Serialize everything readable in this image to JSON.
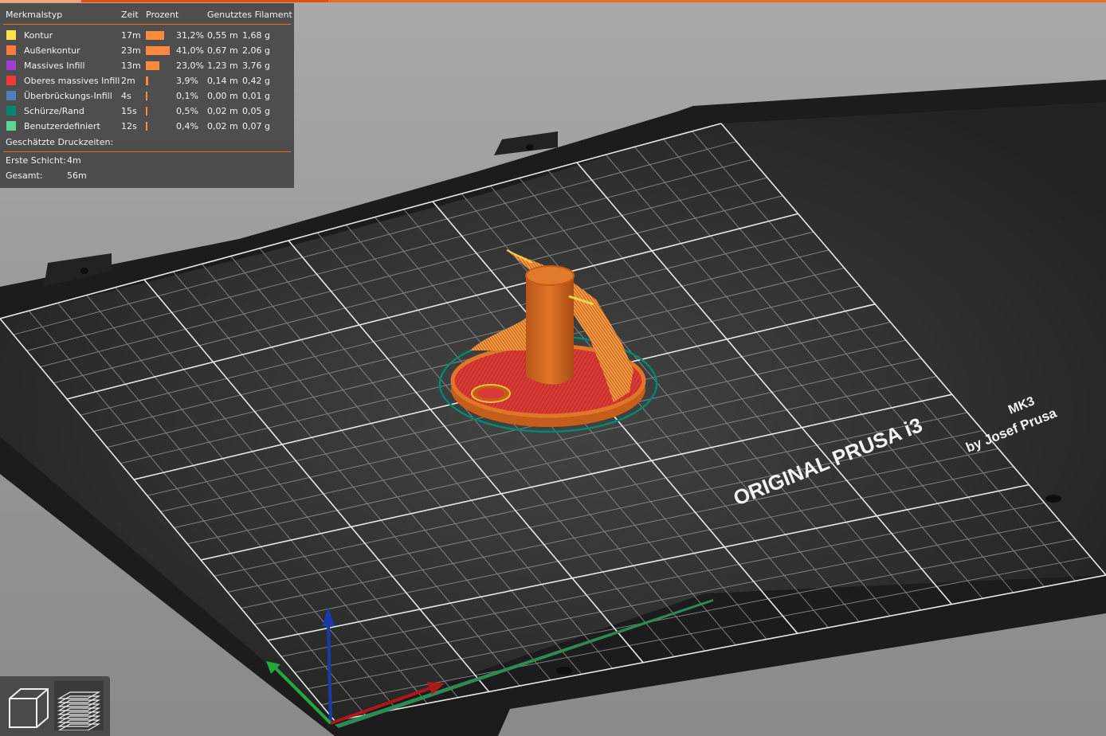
{
  "legend": {
    "headers": {
      "type": "Merkmalstyp",
      "time": "Zeit",
      "percent": "Prozent",
      "filament": "Genutztes Filament"
    },
    "rows": [
      {
        "name": "Kontur",
        "color": "#ffe34a",
        "time": "17m",
        "percent": "31,2%",
        "pct": 31.2,
        "length": "0,55 m",
        "weight": "1,68 g"
      },
      {
        "name": "Außenkontur",
        "color": "#ff7d38",
        "time": "23m",
        "percent": "41,0%",
        "pct": 41.0,
        "length": "0,67 m",
        "weight": "2,06 g"
      },
      {
        "name": "Massives Infill",
        "color": "#9b3fd6",
        "time": "13m",
        "percent": "23,0%",
        "pct": 23.0,
        "length": "1,23 m",
        "weight": "3,76 g"
      },
      {
        "name": "Oberes massives Infill",
        "color": "#f03a3a",
        "time": "2m",
        "percent": "3,9%",
        "pct": 3.9,
        "length": "0,14 m",
        "weight": "0,42 g"
      },
      {
        "name": "Überbrückungs-Infill",
        "color": "#4d80ba",
        "time": "4s",
        "percent": "0,1%",
        "pct": 0.1,
        "length": "0,00 m",
        "weight": "0,01 g"
      },
      {
        "name": "Schürze/Rand",
        "color": "#00876e",
        "time": "15s",
        "percent": "0,5%",
        "pct": 0.5,
        "length": "0,02 m",
        "weight": "0,05 g"
      },
      {
        "name": "Benutzerdefiniert",
        "color": "#5ed498",
        "time": "12s",
        "percent": "0,4%",
        "pct": 0.4,
        "length": "0,02 m",
        "weight": "0,07 g"
      }
    ],
    "estimated_label": "Geschätzte Druckzeiten:",
    "first_layer_label": "Erste Schicht:",
    "first_layer_value": "4m",
    "total_label": "Gesamt:",
    "total_value": "56m"
  },
  "bed": {
    "brand_line": "ORIGINAL PRUSA i3",
    "model": "MK3",
    "maker": "by Josef Prusa"
  },
  "view_buttons": [
    "3d-view",
    "layer-view"
  ],
  "colors": {
    "accent": "#ed6b21",
    "bed_surface": "#2a2a2a",
    "model_orange": "#d9661c",
    "model_red": "#d83a35",
    "skirt": "#00876e"
  }
}
